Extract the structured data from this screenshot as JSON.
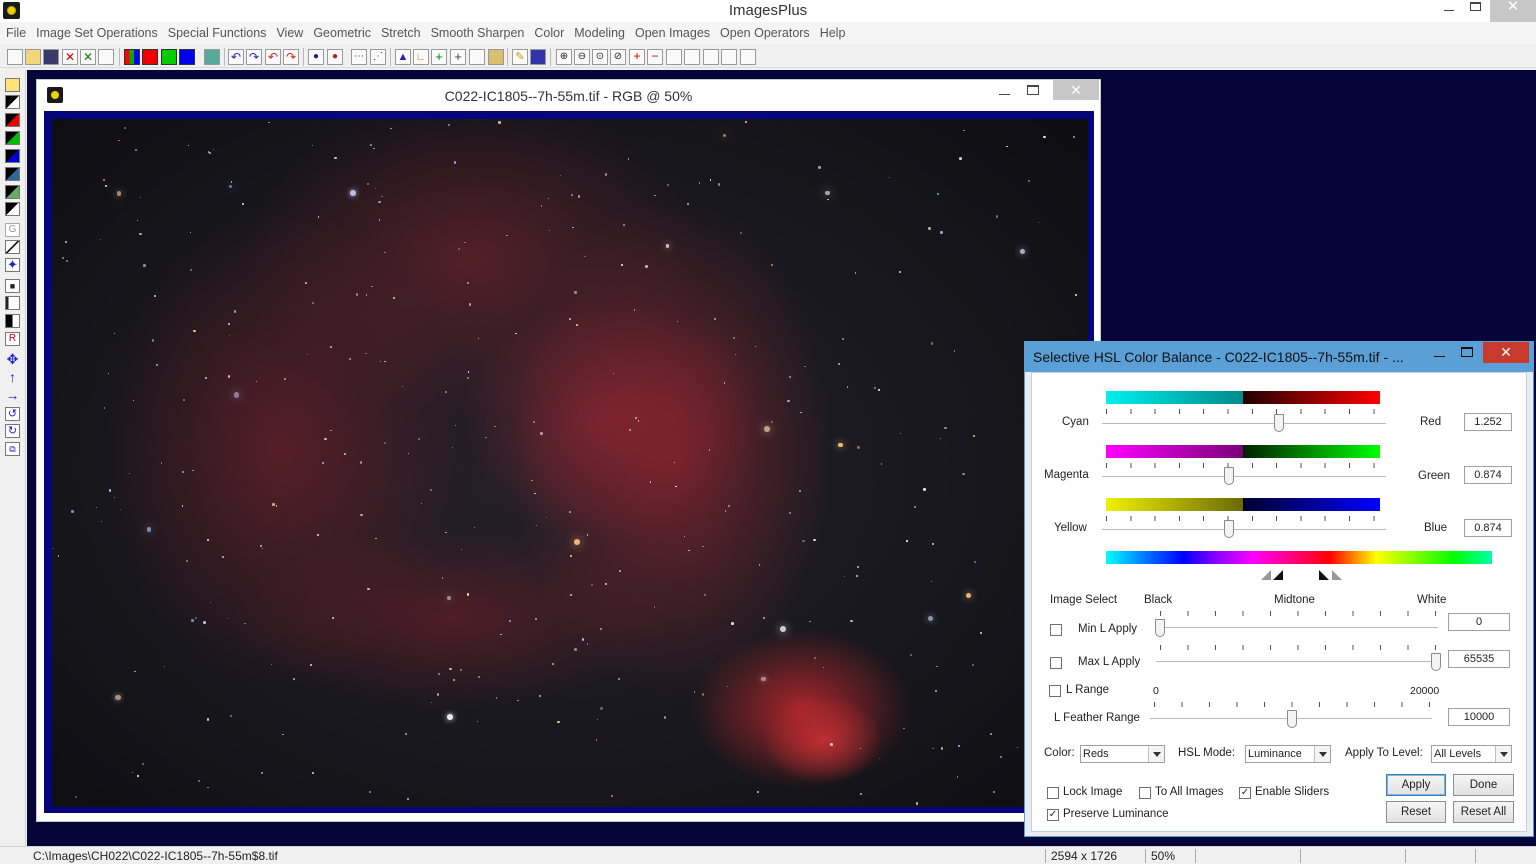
{
  "app": {
    "title": "ImagesPlus"
  },
  "menu": [
    "File",
    "Image Set Operations",
    "Special Functions",
    "View",
    "Geometric",
    "Stretch",
    "Smooth Sharpen",
    "Color",
    "Modeling",
    "Open Images",
    "Open Operators",
    "Help"
  ],
  "image_window": {
    "title": "C022-IC1805--7h-55m.tif - RGB @ 50%"
  },
  "dialog": {
    "title": "Selective HSL Color Balance - C022-IC1805--7h-55m.tif - ...",
    "balance": [
      {
        "left": "Cyan",
        "right": "Red",
        "value": "1.252",
        "position": 0.63
      },
      {
        "left": "Magenta",
        "right": "Green",
        "value": "0.874",
        "position": 0.45
      },
      {
        "left": "Yellow",
        "right": "Blue",
        "value": "0.874",
        "position": 0.45
      }
    ],
    "image_select": {
      "header": "Image Select",
      "black": "Black",
      "midtone": "Midtone",
      "white": "White",
      "min_l": {
        "label": "Min L Apply",
        "value": "0",
        "checked": false,
        "position": 0.0
      },
      "max_l": {
        "label": "Max L Apply",
        "value": "65535",
        "checked": false,
        "position": 1.0
      },
      "l_range": {
        "label": "L Range",
        "checked": false,
        "min": "0",
        "max": "20000"
      },
      "feather": {
        "label": "L Feather Range",
        "value": "10000",
        "position": 0.5
      }
    },
    "color_label": "Color:",
    "color_value": "Reds",
    "hsl_mode_label": "HSL Mode:",
    "hsl_mode_value": "Luminance",
    "apply_level_label": "Apply To Level:",
    "apply_level_value": "All Levels",
    "lock_image": {
      "label": "Lock Image",
      "checked": false
    },
    "to_all_images": {
      "label": "To All Images",
      "checked": false
    },
    "enable_sliders": {
      "label": "Enable Sliders",
      "checked": true
    },
    "preserve_luminance": {
      "label": "Preserve Luminance",
      "checked": true
    },
    "buttons": {
      "apply": "Apply",
      "done": "Done",
      "reset": "Reset",
      "reset_all": "Reset All"
    }
  },
  "status": {
    "path": "C:\\Images\\CH022\\C022-IC1805--7h-55m$8.tif",
    "dimensions": "2594 x 1726",
    "zoom": "50%"
  }
}
